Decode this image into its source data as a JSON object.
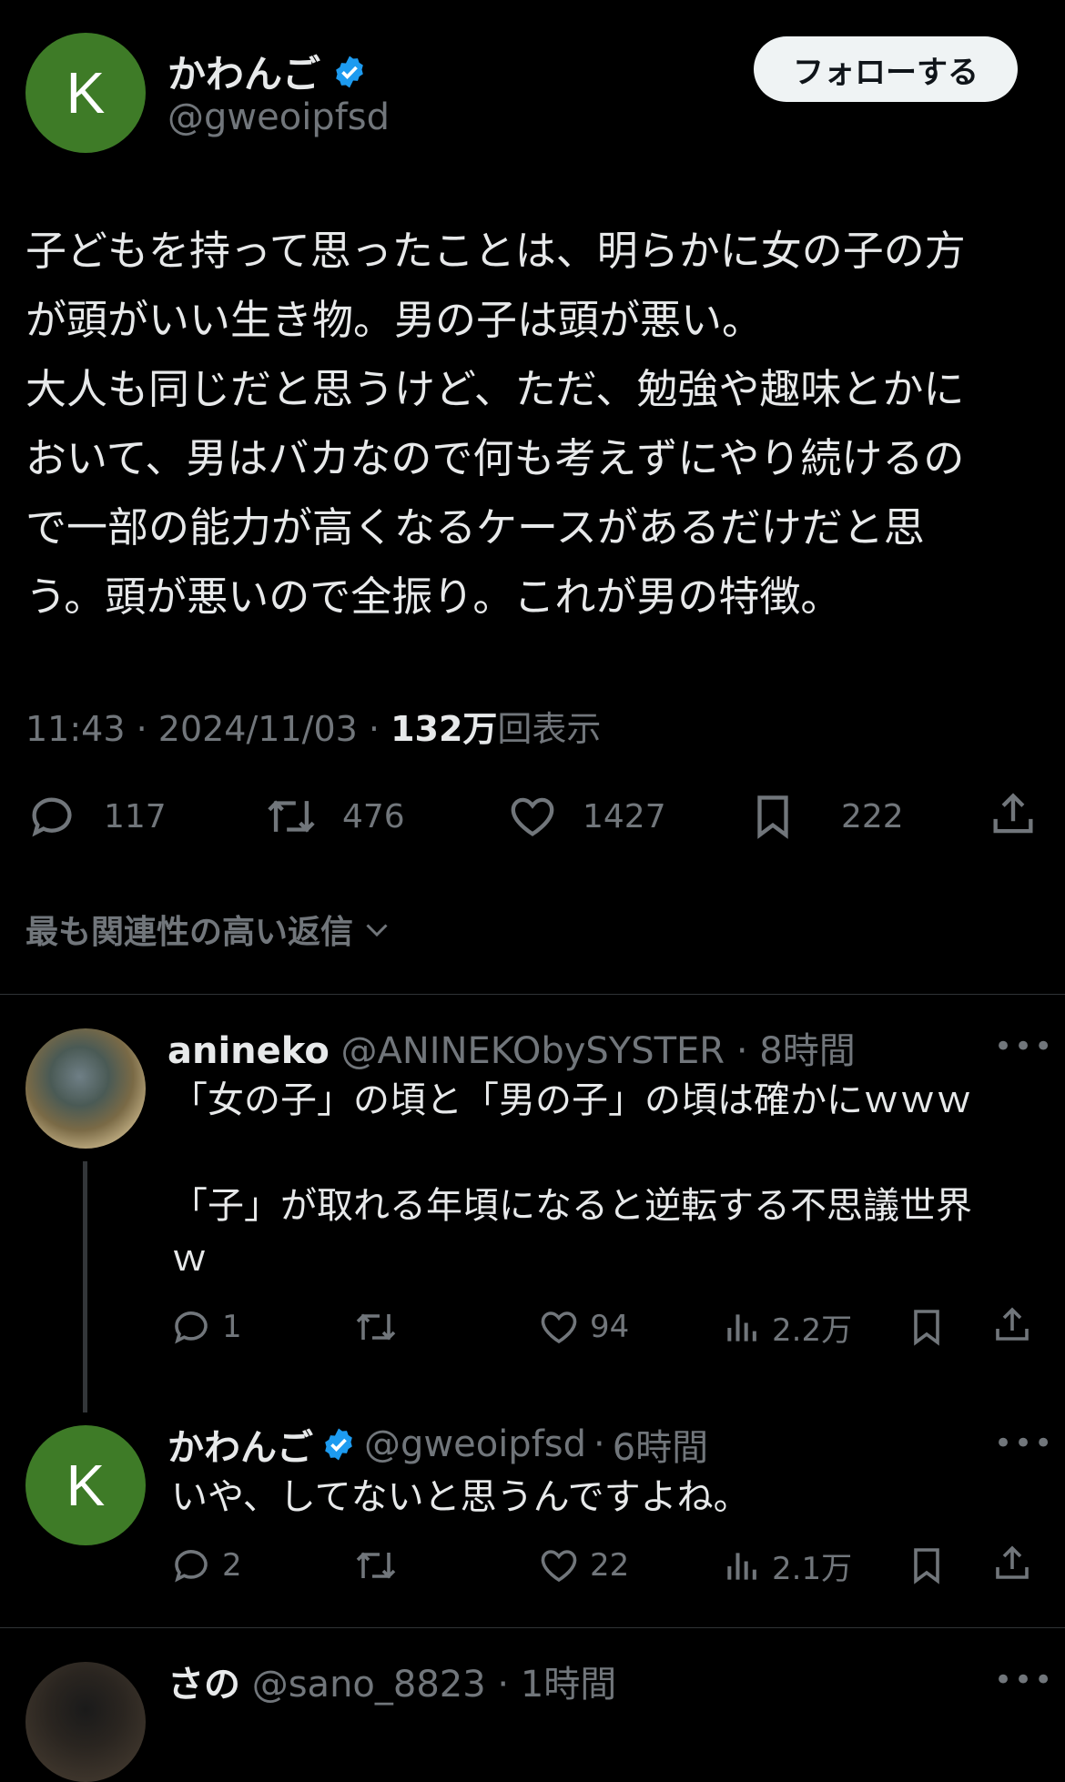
{
  "main_tweet": {
    "avatar_letter": "K",
    "display_name": "かわんご",
    "handle": "@gweoipfsd",
    "follow_label": "フォローする",
    "text": "子どもを持って思ったことは、明らかに女の子の方\nが頭がいい生き物。男の子は頭が悪い。\n大人も同じだと思うけど、ただ、勉強や趣味とかに\nおいて、男はバカなので何も考えずにやり続けるの\nで一部の能力が高くなるケースがあるだけだと思\nう。頭が悪いので全振り。これが男の特徴。",
    "time": "11:43",
    "date": "2024/11/03",
    "views_value": "132万",
    "views_label": "回表示",
    "replies": "117",
    "retweets": "476",
    "likes": "1427",
    "bookmarks": "222"
  },
  "sort_label": "最も関連性の高い返信",
  "replies": [
    {
      "display_name": "anineko",
      "handle": "@ANINEKObySYSTER",
      "time": "8時間",
      "text": "「女の子」の頃と「男の子」の頃は確かにｗｗｗ\n\n「子」が取れる年頃になると逆転する不思議世界\nｗ",
      "replies": "1",
      "likes": "94",
      "views": "2.2万"
    },
    {
      "avatar_letter": "K",
      "display_name": "かわんご",
      "handle": "@gweoipfsd",
      "time": "6時間",
      "text": "いや、してないと思うんですよね。",
      "replies": "2",
      "likes": "22",
      "views": "2.1万"
    },
    {
      "display_name": "さの",
      "handle": "@sano_8823",
      "time": "1時間"
    }
  ],
  "colors": {
    "background": "#000000",
    "text": "#e7e9ea",
    "muted": "#71767b",
    "verified": "#1d9bf0",
    "avatar_k": "#3e7b27"
  },
  "icons": [
    "verified-badge-icon",
    "reply-icon",
    "retweet-icon",
    "like-icon",
    "bookmark-icon",
    "share-icon",
    "views-icon",
    "chevron-down-icon",
    "more-icon"
  ]
}
